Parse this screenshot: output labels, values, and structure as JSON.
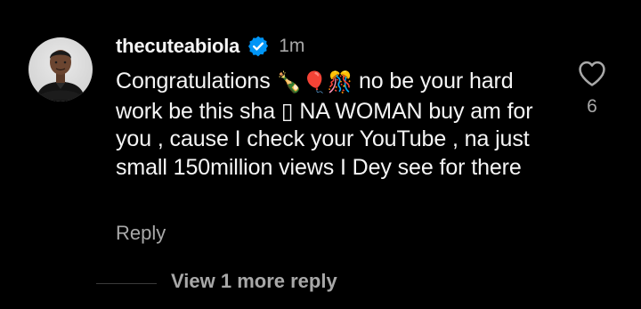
{
  "comment": {
    "username": "thecuteabiola",
    "verified": true,
    "timestamp": "1m",
    "body_segments": {
      "s1": "Congratulations ",
      "e1": "🍾",
      "e2": "🎈",
      "e3": "🎊",
      "s2": " no be your hard work be this sha ",
      "e4": "▯",
      "s3": " NA WOMAN buy am for you , cause I check your YouTube , na just small 150million views I Dey see for there"
    },
    "reply_label": "Reply",
    "like_count": "6"
  },
  "replies": {
    "view_label": "View 1 more reply"
  },
  "icons": {
    "verified": "verified-badge-icon",
    "like": "heart-outline-icon"
  },
  "colors": {
    "background": "#000000",
    "primary_text": "#f5f5f5",
    "secondary_text": "#a8a8a8",
    "verified_blue": "#0095f6"
  }
}
